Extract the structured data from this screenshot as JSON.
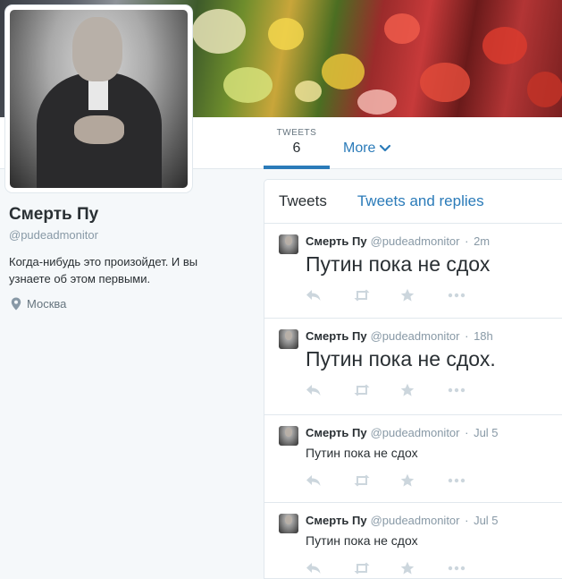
{
  "header": {
    "tweets_label": "TWEETS",
    "tweets_count": "6",
    "more_label": "More"
  },
  "profile": {
    "name": "Смерть Пу",
    "handle": "@pudeadmonitor",
    "bio": "Когда-нибудь это произойдет. И вы узнаете об этом первыми.",
    "location": "Москва"
  },
  "timeline": {
    "tabs": [
      {
        "label": "Tweets"
      },
      {
        "label": "Tweets and replies"
      }
    ],
    "tweets": [
      {
        "name": "Смерть Пу",
        "handle": "@pudeadmonitor",
        "time": "2m",
        "text": "Путин пока не сдох"
      },
      {
        "name": "Смерть Пу",
        "handle": "@pudeadmonitor",
        "time": "18h",
        "text": "Путин пока не сдох."
      },
      {
        "name": "Смерть Пу",
        "handle": "@pudeadmonitor",
        "time": "Jul 5",
        "text": "Путин пока не сдох"
      },
      {
        "name": "Смерть Пу",
        "handle": "@pudeadmonitor",
        "time": "Jul 5",
        "text": "Путин пока не сдох"
      }
    ]
  },
  "icons": {
    "action_icons": [
      "reply-icon",
      "retweet-icon",
      "favorite-icon",
      "more-icon"
    ],
    "location_icon": "map-pin-icon",
    "more_chevron": "chevron-down-icon"
  },
  "colors": {
    "link": "#2b7bb9",
    "muted": "#8899a6",
    "action": "#aab8c2"
  }
}
